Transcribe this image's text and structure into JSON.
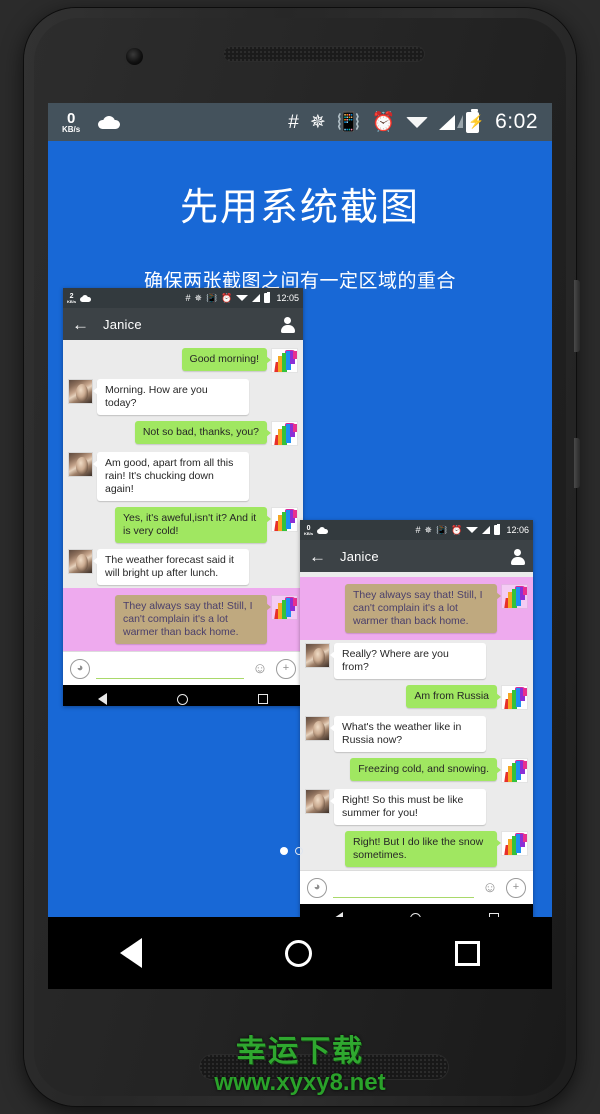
{
  "status_bar": {
    "net_speed_value": "0",
    "net_speed_unit": "KB/s",
    "cloud_icon": "cloud-icon",
    "icons": [
      "hash-icon",
      "bluetooth-icon",
      "vibrate-icon",
      "alarm-icon",
      "wifi-icon",
      "cellular-signal-icon",
      "battery-charging-icon"
    ],
    "hash": "#",
    "bluetooth": "✱",
    "vibrate": "ᵘ0",
    "alarm": "⏰",
    "clock": "6:02"
  },
  "headline": {
    "title": "先用系统截图",
    "subtitle": "确保两张截图之间有一定区域的重合"
  },
  "screenshot_one": {
    "status": {
      "speed_num": "2",
      "speed_unit": "KB/s",
      "hash": "#",
      "bluetooth": "✱",
      "vibrate": "ᵘ0",
      "alarm": "⏰",
      "clock": "12:05"
    },
    "toolbar": {
      "back": "←",
      "title": "Janice",
      "contact_icon": "contact-icon"
    },
    "messages": [
      {
        "side": "out",
        "text": "Good morning!",
        "highlight": false
      },
      {
        "side": "in",
        "text": "Morning. How are you today?",
        "highlight": false
      },
      {
        "side": "out",
        "text": "Not so bad, thanks, you?",
        "highlight": false
      },
      {
        "side": "in",
        "text": "Am good, apart from all this rain! It's chucking down again!",
        "highlight": false
      },
      {
        "side": "out",
        "text": "Yes, it's aweful,isn't it? And it is very cold!",
        "highlight": false
      },
      {
        "side": "in",
        "text": "The weather forecast said it will bright up after lunch.",
        "highlight": false
      },
      {
        "side": "out",
        "text": "They always say that! Still, I can't complain it's a lot warmer than back home.",
        "highlight": true
      }
    ],
    "input_bar": {
      "voice_icon": "⦷",
      "emoji_icon": "☺",
      "add_icon": "＋",
      "placeholder": ""
    },
    "navbar": {
      "back": "back-icon",
      "home": "home-icon",
      "recents": "recents-icon"
    }
  },
  "screenshot_two": {
    "status": {
      "speed_num": "0",
      "speed_unit": "KB/s",
      "hash": "#",
      "bluetooth": "✱",
      "vibrate": "ᵘ0",
      "alarm": "⏰",
      "clock": "12:06"
    },
    "toolbar": {
      "back": "←",
      "title": "Janice",
      "contact_icon": "contact-icon"
    },
    "messages": [
      {
        "side": "out",
        "text": "They always say that! Still, I can't complain it's a lot warmer than back home.",
        "highlight": true
      },
      {
        "side": "in",
        "text": "Really? Where are you from?",
        "highlight": false
      },
      {
        "side": "out",
        "text": "Am from Russia",
        "highlight": false
      },
      {
        "side": "in",
        "text": "What's the weather like in Russia now?",
        "highlight": false
      },
      {
        "side": "out",
        "text": "Freezing cold, and snowing.",
        "highlight": false
      },
      {
        "side": "in",
        "text": "Right! So this must be like summer for you!",
        "highlight": false
      },
      {
        "side": "out",
        "text": "Right! But I do like the snow sometimes.",
        "highlight": false
      }
    ],
    "input_bar": {
      "voice_icon": "⦷",
      "emoji_icon": "☺",
      "add_icon": "＋",
      "placeholder": ""
    },
    "navbar": {
      "back": "back-icon",
      "home": "home-icon",
      "recents": "recents-icon"
    }
  },
  "page_dots": {
    "total": 2,
    "active_index": 0
  },
  "device_navbar": {
    "back": "back-icon",
    "home": "home-icon",
    "recents": "recents-icon"
  },
  "watermark": {
    "brand": "幸运下载",
    "url": "www.xyxy8.net"
  },
  "colors": {
    "accent_blue": "#1868d6",
    "status_bar": "#44525c",
    "bubble_out": "#a0e761",
    "bubble_in": "#ffffff",
    "overlap_highlight": "#eeaaee",
    "overlap_bubble": "#bfa97f",
    "watermark_green": "#2fa82f"
  }
}
